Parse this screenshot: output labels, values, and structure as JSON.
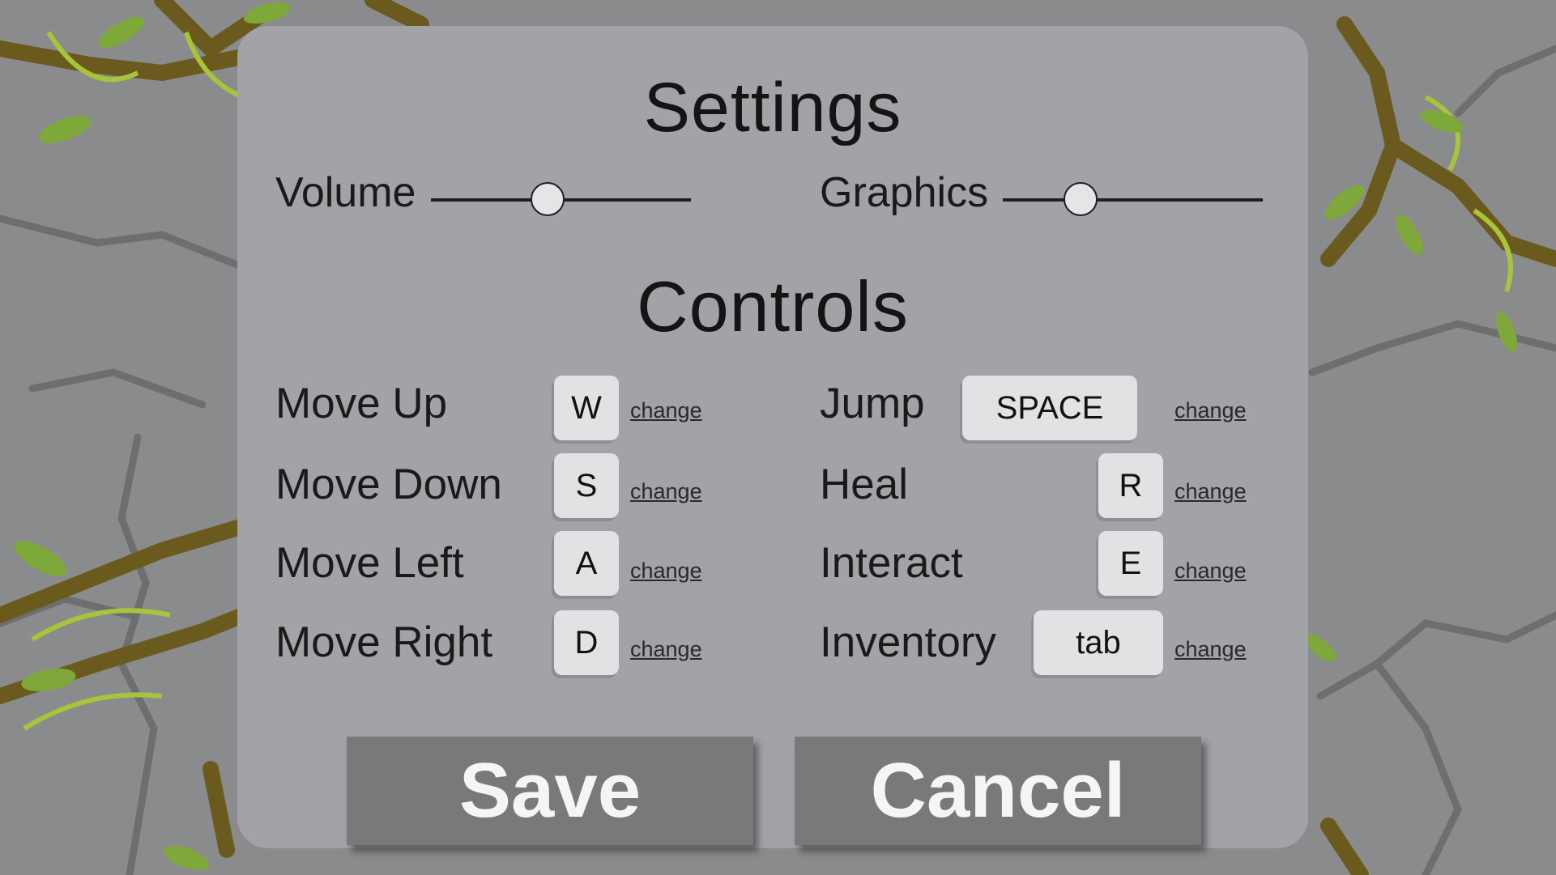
{
  "settings": {
    "title": "Settings",
    "volume": {
      "label": "Volume",
      "level": 0.45
    },
    "graphics": {
      "label": "Graphics",
      "level": 0.3
    }
  },
  "controls": {
    "title": "Controls",
    "change_label": "change",
    "left": [
      {
        "action": "Move Up",
        "key": "W"
      },
      {
        "action": "Move Down",
        "key": "S"
      },
      {
        "action": "Move Left",
        "key": "A"
      },
      {
        "action": "Move Right",
        "key": "D"
      }
    ],
    "right": [
      {
        "action": "Jump",
        "key": "SPACE"
      },
      {
        "action": "Heal",
        "key": "R"
      },
      {
        "action": "Interact",
        "key": "E"
      },
      {
        "action": "Inventory",
        "key": "tab"
      }
    ]
  },
  "buttons": {
    "save": "Save",
    "cancel": "Cancel"
  },
  "colors": {
    "panel": "#a1a3a6",
    "button": "#78797b",
    "keycap": "#e1e2e3",
    "background": "#8a8b8c",
    "vine": "#6b5a1e",
    "leaf": "#9cbf2f"
  }
}
